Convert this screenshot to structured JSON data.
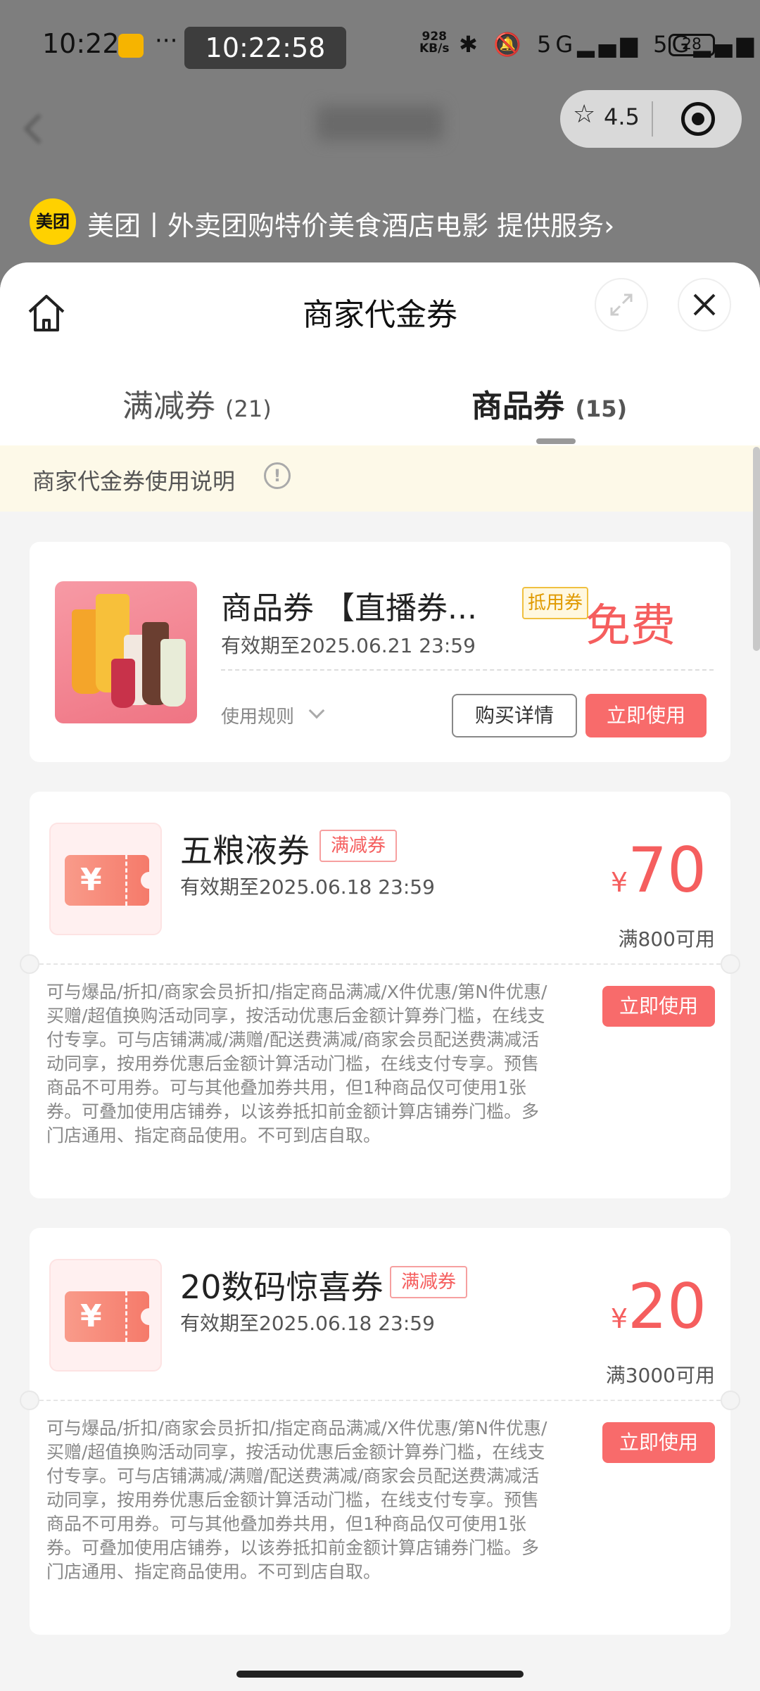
{
  "status_bar": {
    "time": "10:22",
    "more": "···",
    "clock_overlay": "10:22:58",
    "net_speed_value": "928",
    "net_speed_unit": "KB/s",
    "signal_icons": "✱ 🔕 5G▂▄▆ 5G▂▄▆",
    "battery": "28"
  },
  "capsule": {
    "rating": "4.5"
  },
  "provider": {
    "logo_text": "美团",
    "text": "美团丨外卖团购特价美食酒店电影 提供服务›"
  },
  "sheet": {
    "title": "商家代金券"
  },
  "tabs": [
    {
      "label": "满减券",
      "count": "(21)",
      "active": false
    },
    {
      "label": "商品券",
      "count": "(15)",
      "active": true
    }
  ],
  "notice": {
    "text": "商家代金券使用说明",
    "icon": "!"
  },
  "product_coupon": {
    "title": "商品券 【直播券...",
    "badge": "抵用券",
    "price": "免费",
    "valid": "有效期至2025.06.21 23:59",
    "rules_label": "使用规则",
    "detail_button": "购买详情",
    "use_button": "立即使用"
  },
  "coupons": [
    {
      "title": "五粮液券",
      "badge": "满减券",
      "valid": "有效期至2025.06.18 23:59",
      "currency": "¥",
      "amount": "70",
      "condition": "满800可用",
      "use_button": "立即使用",
      "description": "可与爆品/折扣/商家会员折扣/指定商品满减/X件优惠/第N件优惠/买赠/超值换购活动同享，按活动优惠后金额计算券门槛，在线支付专享。可与店铺满减/满赠/配送费满减/商家会员配送费满减活动同享，按用券优惠后金额计算活动门槛，在线支付专享。预售商品不可用券。可与其他叠加券共用，但1种商品仅可使用1张券。可叠加使用店铺券，以该券抵扣前金额计算店铺券门槛。多门店通用、指定商品使用。不可到店自取。"
    },
    {
      "title": "20数码惊喜券",
      "badge": "满减券",
      "valid": "有效期至2025.06.18 23:59",
      "currency": "¥",
      "amount": "20",
      "condition": "满3000可用",
      "use_button": "立即使用",
      "description": "可与爆品/折扣/商家会员折扣/指定商品满减/X件优惠/第N件优惠/买赠/超值换购活动同享，按活动优惠后金额计算券门槛，在线支付专享。可与店铺满减/满赠/配送费满减/商家会员配送费满减活动同享，按用券优惠后金额计算活动门槛，在线支付专享。预售商品不可用券。可与其他叠加券共用，但1种商品仅可使用1张券。可叠加使用店铺券，以该券抵扣前金额计算店铺券门槛。多门店通用、指定商品使用。不可到店自取。"
    }
  ],
  "colors": {
    "accent_red": "#f55e5e",
    "button_red": "#f86b6b",
    "notice_bg": "#fdf9e8",
    "badge_gold": "#e09a00"
  }
}
